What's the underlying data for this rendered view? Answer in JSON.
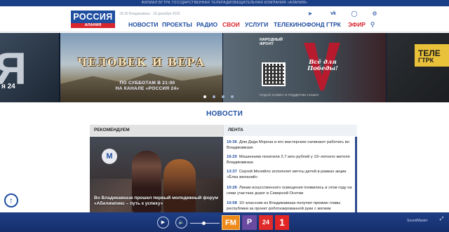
{
  "top_strip": "ФИЛИАЛ ВГТРК ГОСУДАРСТВЕННАЯ ТЕЛЕРАДИОВЕЩАТЕЛЬНАЯ КОМПАНИЯ «АЛАНИЯ»",
  "logo": {
    "line1": "РОССИЯ",
    "line2": "АЛАНИЯ"
  },
  "datetime": "18:30 Владикавказ · 18 декабря 2025",
  "top_icons": [
    "telegram-icon",
    "vk-icon",
    "ok-icon",
    "settings-icon"
  ],
  "nav": [
    "НОВОСТИ",
    "ПРОЕКТЫ",
    "РАДИО",
    "СВОИ",
    "УСЛУГИ",
    "ТЕЛЕКИНОФОНД",
    "ГТРК",
    "ЭФИР"
  ],
  "carousel": {
    "left_sub": "я 24",
    "main_title": "ЧЕЛОВЕК И ВЕРА",
    "main_schedule_1": "ПО СУББОТАМ В 21:00",
    "main_schedule_2": "НА КАНАЛЕ «РОССИЯ 24»",
    "front_label_1": "НАРОДНЫЙ",
    "front_label_2": "ФРОНТ",
    "front_slogan_1": "Всё для",
    "front_slogan_2": "Победы!",
    "front_footer": "ПОДАЙ ЗАЯВКУ И ПОДДЕРЖИ НАШИХ",
    "right_label": "ТЕЛЕ",
    "right_label_2": "ГТРК",
    "active_dot": 0,
    "dot_count": 4
  },
  "news": {
    "section_title": "НОВОСТИ",
    "tab_recommended": "РЕКОМЕНДУЕМ",
    "tab_feed": "ЛЕНТА",
    "feature_logo": "M",
    "feature_caption": "Во Владикавказе прошел первый молодежный форум «Абилимпикс – путь к успеху»",
    "feed": [
      {
        "time": "16:36",
        "text": "Дом Деда Мороза и его мастерские начинают работать во Владикавказе"
      },
      {
        "time": "16:20",
        "text": "Мошенники похитили 2,7 млн рублей у 19–летнего жителя Владикавказа"
      },
      {
        "time": "13:37",
        "text": "Сергей Меняйло исполняет мечты детей в рамках акции «Ёлка желаний»"
      },
      {
        "time": "10:26",
        "text": "Линии искусственного освещения появились в этом году на семи участках дорог в Северной Осетии"
      },
      {
        "time": "10:08",
        "text": "10–классник из Владикавказа получил премию главы республики за проект роботизированной руки с мягким"
      }
    ]
  },
  "player": {
    "channels": [
      "FM",
      "Р",
      "24",
      "1"
    ],
    "volume": 0.45,
    "brand": "SoundMaster"
  }
}
